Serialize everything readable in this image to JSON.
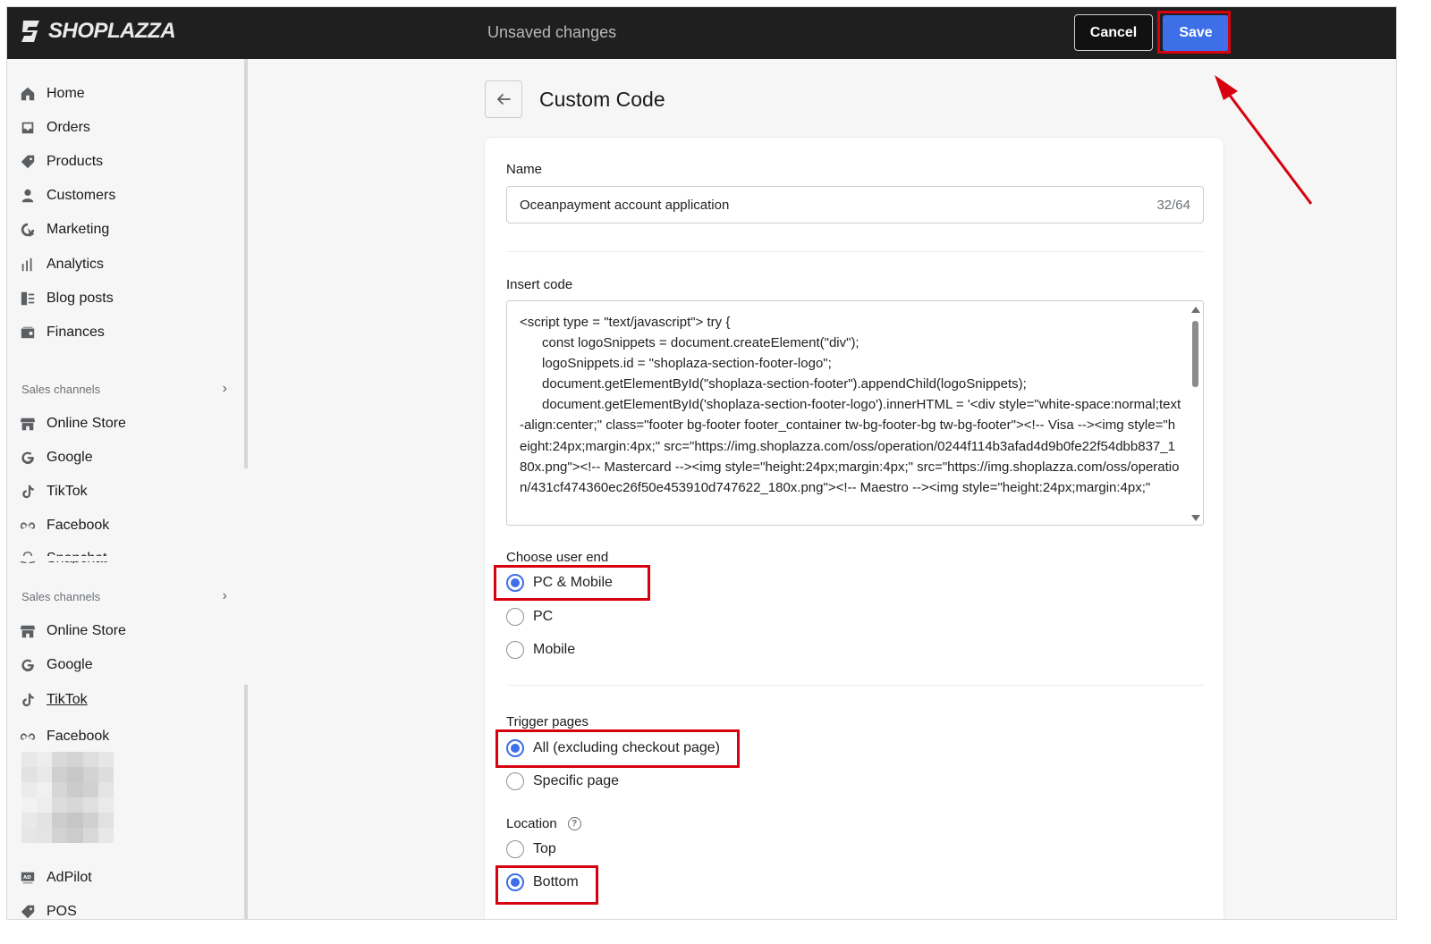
{
  "topbar": {
    "brand": "SHOPLAZZA",
    "status": "Unsaved changes",
    "cancel_label": "Cancel",
    "save_label": "Save"
  },
  "sidebar": {
    "items": [
      {
        "label": "Home",
        "icon": "home-icon"
      },
      {
        "label": "Orders",
        "icon": "orders-icon"
      },
      {
        "label": "Products",
        "icon": "tag-icon"
      },
      {
        "label": "Customers",
        "icon": "person-icon"
      },
      {
        "label": "Marketing",
        "icon": "target-icon"
      },
      {
        "label": "Analytics",
        "icon": "bar-chart-icon"
      },
      {
        "label": "Blog posts",
        "icon": "blog-icon"
      },
      {
        "label": "Finances",
        "icon": "wallet-icon"
      }
    ],
    "sales_channels_heading": "Sales channels",
    "channels": [
      {
        "label": "Online Store",
        "icon": "store-icon"
      },
      {
        "label": "Google",
        "icon": "google-icon"
      },
      {
        "label": "TikTok",
        "icon": "tiktok-icon"
      },
      {
        "label": "Facebook",
        "icon": "meta-icon"
      },
      {
        "label": "Snapchat",
        "icon": "snapchat-icon"
      }
    ],
    "channels2": [
      {
        "label": "Online Store",
        "icon": "store-icon"
      },
      {
        "label": "Google",
        "icon": "google-icon"
      },
      {
        "label": "TikTok",
        "icon": "tiktok-icon"
      },
      {
        "label": "Facebook",
        "icon": "meta-icon"
      }
    ],
    "apps": [
      {
        "label": "AdPilot",
        "icon": "adpilot-icon"
      },
      {
        "label": "POS",
        "icon": "pos-tag-icon"
      }
    ]
  },
  "page": {
    "title": "Custom Code",
    "name_label": "Name",
    "name_value": "Oceanpayment account application",
    "name_counter": "32/64",
    "insert_code_label": "Insert code",
    "code": "<script type = \"text/javascript\"> try {\n      const logoSnippets = document.createElement(\"div\");\n      logoSnippets.id = \"shoplaza-section-footer-logo\";\n      document.getElementById(\"shoplaza-section-footer\").appendChild(logoSnippets);\n      document.getElementById('shoplaza-section-footer-logo').innerHTML = '<div style=\"white-space:normal;text-align:center;\" class=\"footer bg-footer footer_container tw-bg-footer-bg tw-bg-footer\"><!-- Visa --><img style=\"height:24px;margin:4px;\" src=\"https://img.shoplazza.com/oss/operation/0244f114b3afad4d9b0fe22f54dbb837_180x.png\"><!-- Mastercard --><img style=\"height:24px;margin:4px;\" src=\"https://img.shoplazza.com/oss/operation/431cf474360ec26f50e453910d747622_180x.png\"><!-- Maestro --><img style=\"height:24px;margin:4px;\"",
    "user_end_label": "Choose user end",
    "user_end_options": [
      "PC & Mobile",
      "PC",
      "Mobile"
    ],
    "user_end_selected": "PC & Mobile",
    "trigger_label": "Trigger pages",
    "trigger_options": [
      "All (excluding checkout page)",
      "Specific page"
    ],
    "trigger_selected": "All (excluding checkout page)",
    "location_label": "Location",
    "location_options": [
      "Top",
      "Bottom"
    ],
    "location_selected": "Bottom"
  },
  "colors": {
    "accent": "#3d6fe8",
    "highlight": "#d7000f",
    "topbar": "#1f1f1f"
  }
}
